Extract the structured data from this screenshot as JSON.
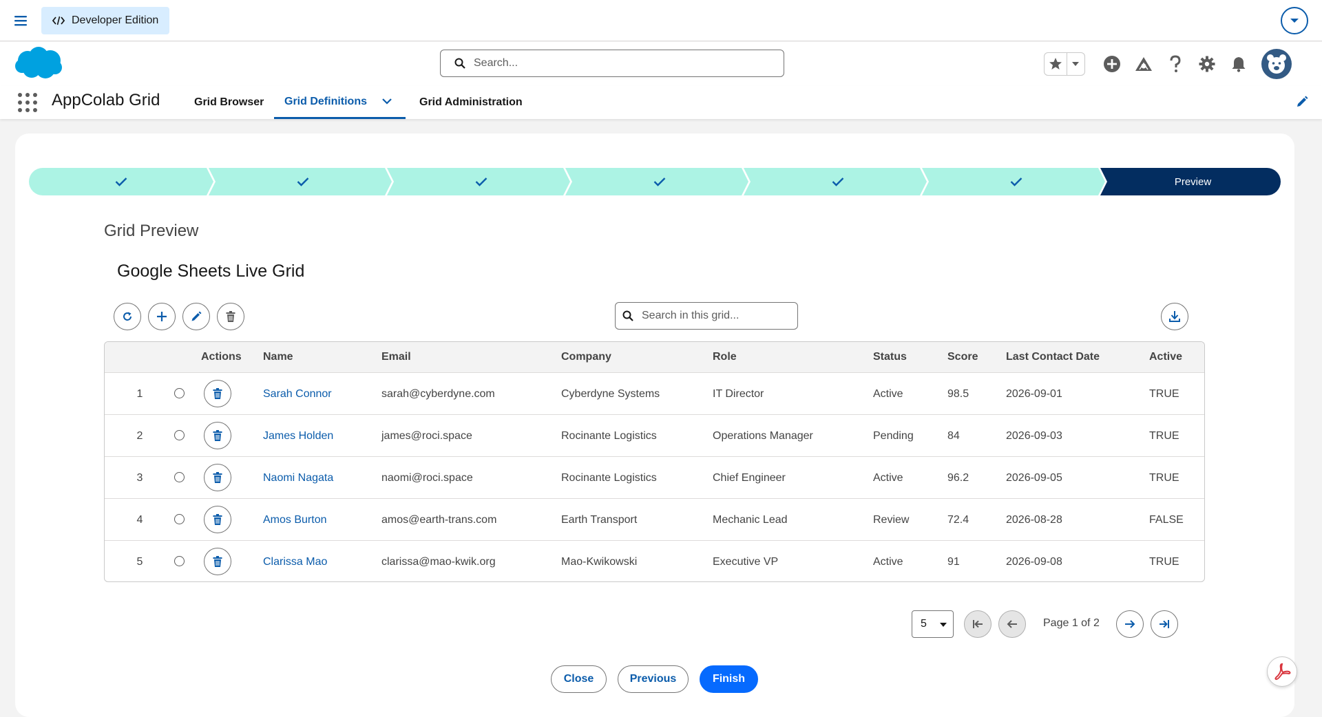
{
  "topbar": {
    "badge": "Developer Edition"
  },
  "header": {
    "search_placeholder": "Search..."
  },
  "app": {
    "name": "AppColab Grid",
    "nav": [
      {
        "label": "Grid Browser",
        "active": false
      },
      {
        "label": "Grid Definitions",
        "active": true,
        "has_dropdown": true
      },
      {
        "label": "Grid Administration",
        "active": false
      }
    ]
  },
  "path": {
    "steps": [
      {
        "state": "complete",
        "icon": "check-icon"
      },
      {
        "state": "complete",
        "icon": "check-icon"
      },
      {
        "state": "complete",
        "icon": "check-icon"
      },
      {
        "state": "complete",
        "icon": "check-icon"
      },
      {
        "state": "complete",
        "icon": "check-icon"
      },
      {
        "state": "complete",
        "icon": "check-icon"
      },
      {
        "state": "current",
        "label": "Preview"
      }
    ],
    "colors": {
      "complete": "#acf3e4",
      "current": "#032d60",
      "check": "#0b5cab"
    }
  },
  "main": {
    "section_title": "Grid Preview",
    "grid_name": "Google Sheets Live Grid",
    "grid_search_placeholder": "Search in this grid..."
  },
  "table": {
    "columns": [
      "Actions",
      "Name",
      "Email",
      "Company",
      "Role",
      "Status",
      "Score",
      "Last Contact Date",
      "Active"
    ],
    "rows": [
      {
        "num": "1",
        "name": "Sarah Connor",
        "email": "sarah@cyberdyne.com",
        "company": "Cyberdyne Systems",
        "role": "IT Director",
        "status": "Active",
        "score": "98.5",
        "last_contact": "2026-09-01",
        "active": "TRUE"
      },
      {
        "num": "2",
        "name": "James Holden",
        "email": "james@roci.space",
        "company": "Rocinante Logistics",
        "role": "Operations Manager",
        "status": "Pending",
        "score": "84",
        "last_contact": "2026-09-03",
        "active": "TRUE"
      },
      {
        "num": "3",
        "name": "Naomi Nagata",
        "email": "naomi@roci.space",
        "company": "Rocinante Logistics",
        "role": "Chief Engineer",
        "status": "Active",
        "score": "96.2",
        "last_contact": "2026-09-05",
        "active": "TRUE"
      },
      {
        "num": "4",
        "name": "Amos Burton",
        "email": "amos@earth-trans.com",
        "company": "Earth Transport",
        "role": "Mechanic Lead",
        "status": "Review",
        "score": "72.4",
        "last_contact": "2026-08-28",
        "active": "FALSE"
      },
      {
        "num": "5",
        "name": "Clarissa Mao",
        "email": "clarissa@mao-kwik.org",
        "company": "Mao-Kwikowski",
        "role": "Executive VP",
        "status": "Active",
        "score": "91",
        "last_contact": "2026-09-08",
        "active": "TRUE"
      }
    ]
  },
  "pagination": {
    "page_size": "5",
    "page_info": "Page 1 of 2"
  },
  "footer": {
    "close": "Close",
    "previous": "Previous",
    "finish": "Finish"
  },
  "colors": {
    "brand": "#066afe",
    "link": "#0b5cab",
    "salesforce_cloud": "#00a1e0"
  }
}
